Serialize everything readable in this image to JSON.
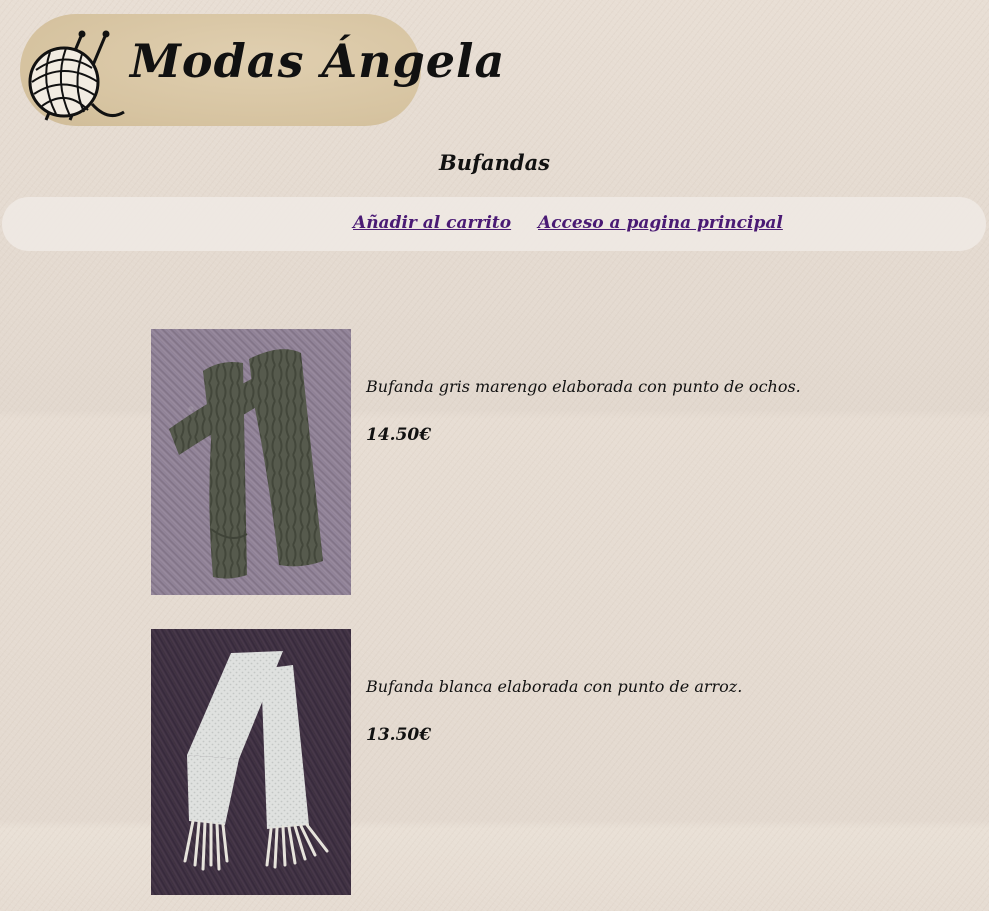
{
  "brand": {
    "name": "Modas Ángela"
  },
  "page": {
    "title": "Bufandas"
  },
  "nav": {
    "add_to_cart": "Añadir al carrito",
    "home": "Acceso a pagina principal"
  },
  "products": [
    {
      "description": "Bufanda gris marengo elaborada con punto de ochos.",
      "price": "14.50€"
    },
    {
      "description": "Bufanda blanca elaborada con punto de arroz.",
      "price": "13.50€"
    }
  ],
  "colors": {
    "link": "#4a1a74",
    "logo_background": "#d9c7a6",
    "page_background": "#e6dcd2",
    "nav_background": "#f0eae5"
  }
}
